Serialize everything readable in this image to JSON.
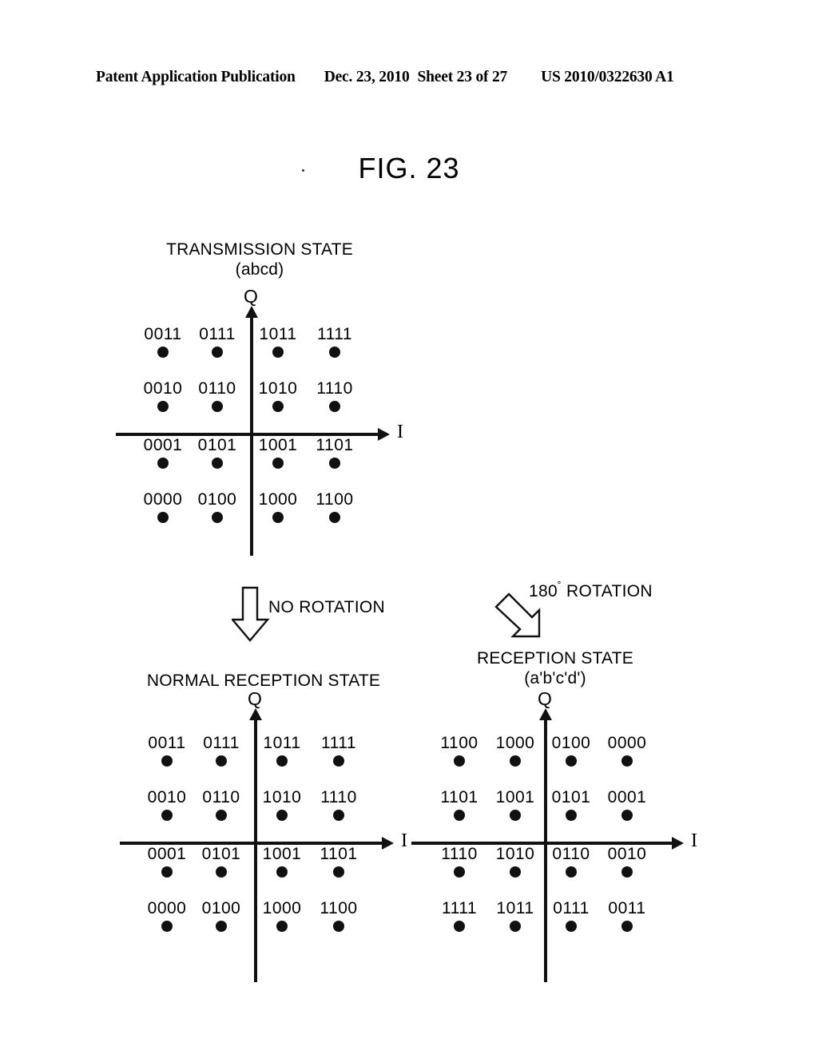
{
  "header": {
    "left": "Patent Application Publication",
    "date": "Dec. 23, 2010",
    "sheet": "Sheet 23 of 27",
    "pub_number": "US 2010/0322630 A1"
  },
  "figure": {
    "title": "FIG. 23"
  },
  "axis_labels": {
    "q": "Q",
    "i": "I"
  },
  "annotations": {
    "no_rotation": {
      "label": "NO ROTATION",
      "icon": "arrow-down-hollow-icon"
    },
    "rotation_180": {
      "degrees": "180",
      "degree_symbol": "˚",
      "label": " ROTATION",
      "full_label": "180˚ ROTATION",
      "icon": "arrow-diagonal-down-right-hollow-icon"
    }
  },
  "chart_data": [
    {
      "id": "transmission-state",
      "type": "scatter",
      "title": "TRANSMISSION STATE",
      "subtitle": "(abcd)",
      "xlabel": "I",
      "ylabel": "Q",
      "grid": false,
      "xlim": [
        -4,
        4
      ],
      "ylim": [
        -4,
        4
      ],
      "note": "16-QAM constellation, Gray-ish mapping, labels above each point",
      "points": [
        {
          "label": "0011",
          "x": -3,
          "y": 3
        },
        {
          "label": "0111",
          "x": -1,
          "y": 3
        },
        {
          "label": "1011",
          "x": 1,
          "y": 3
        },
        {
          "label": "1111",
          "x": 3,
          "y": 3
        },
        {
          "label": "0010",
          "x": -3,
          "y": 1
        },
        {
          "label": "0110",
          "x": -1,
          "y": 1
        },
        {
          "label": "1010",
          "x": 1,
          "y": 1
        },
        {
          "label": "1110",
          "x": 3,
          "y": 1
        },
        {
          "label": "0001",
          "x": -3,
          "y": -1
        },
        {
          "label": "0101",
          "x": -1,
          "y": -1
        },
        {
          "label": "1001",
          "x": 1,
          "y": -1
        },
        {
          "label": "1101",
          "x": 3,
          "y": -1
        },
        {
          "label": "0000",
          "x": -3,
          "y": -3
        },
        {
          "label": "0100",
          "x": -1,
          "y": -3
        },
        {
          "label": "1000",
          "x": 1,
          "y": -3
        },
        {
          "label": "1100",
          "x": 3,
          "y": -3
        }
      ]
    },
    {
      "id": "normal-reception-state",
      "type": "scatter",
      "title": "NORMAL RECEPTION STATE",
      "subtitle": "",
      "xlabel": "I",
      "ylabel": "Q",
      "grid": false,
      "xlim": [
        -4,
        4
      ],
      "ylim": [
        -4,
        4
      ],
      "note": "Identical to transmission state (no rotation)",
      "points": [
        {
          "label": "0011",
          "x": -3,
          "y": 3
        },
        {
          "label": "0111",
          "x": -1,
          "y": 3
        },
        {
          "label": "1011",
          "x": 1,
          "y": 3
        },
        {
          "label": "1111",
          "x": 3,
          "y": 3
        },
        {
          "label": "0010",
          "x": -3,
          "y": 1
        },
        {
          "label": "0110",
          "x": -1,
          "y": 1
        },
        {
          "label": "1010",
          "x": 1,
          "y": 1
        },
        {
          "label": "1110",
          "x": 3,
          "y": 1
        },
        {
          "label": "0001",
          "x": -3,
          "y": -1
        },
        {
          "label": "0101",
          "x": -1,
          "y": -1
        },
        {
          "label": "1001",
          "x": 1,
          "y": -1
        },
        {
          "label": "1101",
          "x": 3,
          "y": -1
        },
        {
          "label": "0000",
          "x": -3,
          "y": -3
        },
        {
          "label": "0100",
          "x": -1,
          "y": -3
        },
        {
          "label": "1000",
          "x": 1,
          "y": -3
        },
        {
          "label": "1100",
          "x": 3,
          "y": -3
        }
      ]
    },
    {
      "id": "reception-state-rotated",
      "type": "scatter",
      "title": "RECEPTION STATE",
      "subtitle": "(a'b'c'd')",
      "xlabel": "I",
      "ylabel": "Q",
      "grid": false,
      "xlim": [
        -4,
        4
      ],
      "ylim": [
        -4,
        4
      ],
      "note": "Constellation after 180 degree rotation",
      "points": [
        {
          "label": "1100",
          "x": -3,
          "y": 3
        },
        {
          "label": "1000",
          "x": -1,
          "y": 3
        },
        {
          "label": "0100",
          "x": 1,
          "y": 3
        },
        {
          "label": "0000",
          "x": 3,
          "y": 3
        },
        {
          "label": "1101",
          "x": -3,
          "y": 1
        },
        {
          "label": "1001",
          "x": -1,
          "y": 1
        },
        {
          "label": "0101",
          "x": 1,
          "y": 1
        },
        {
          "label": "0001",
          "x": 3,
          "y": 1
        },
        {
          "label": "1110",
          "x": -3,
          "y": -1
        },
        {
          "label": "1010",
          "x": -1,
          "y": -1
        },
        {
          "label": "0110",
          "x": 1,
          "y": -1
        },
        {
          "label": "0010",
          "x": 3,
          "y": -1
        },
        {
          "label": "1111",
          "x": -3,
          "y": -3
        },
        {
          "label": "1011",
          "x": -1,
          "y": -3
        },
        {
          "label": "0111",
          "x": 1,
          "y": -3
        },
        {
          "label": "0011",
          "x": 3,
          "y": -3
        }
      ]
    }
  ]
}
